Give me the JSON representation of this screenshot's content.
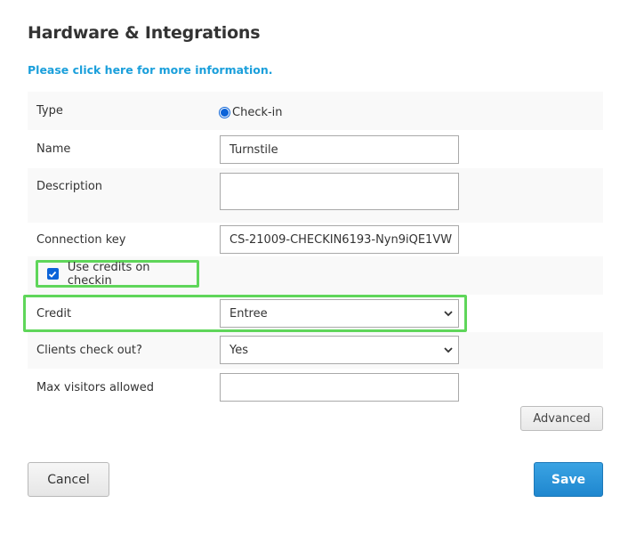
{
  "page": {
    "title": "Hardware & Integrations",
    "info_link": "Please click here for more information."
  },
  "form": {
    "type": {
      "label": "Type",
      "option": "Check-in",
      "selected": true
    },
    "name": {
      "label": "Name",
      "value": "Turnstile"
    },
    "description": {
      "label": "Description",
      "value": ""
    },
    "connection_key": {
      "label": "Connection key",
      "value": "CS-21009-CHECKIN6193-Nyn9iQE1VW"
    },
    "use_credits": {
      "label": "Use credits on checkin",
      "checked": true
    },
    "credit": {
      "label": "Credit",
      "value": "Entree"
    },
    "clients_check_out": {
      "label": "Clients check out?",
      "value": "Yes"
    },
    "max_visitors": {
      "label": "Max visitors allowed",
      "value": ""
    }
  },
  "buttons": {
    "advanced": "Advanced",
    "cancel": "Cancel",
    "save": "Save"
  },
  "icons": {
    "radio": "radio-selected-icon",
    "checkbox": "checkbox-checked-icon",
    "select_chevron": "chevron-down-icon"
  },
  "colors": {
    "link": "#1a9fdb",
    "primary": "#2590d8",
    "highlight": "#5fd65a",
    "row_shade": "#f9f9f9"
  }
}
